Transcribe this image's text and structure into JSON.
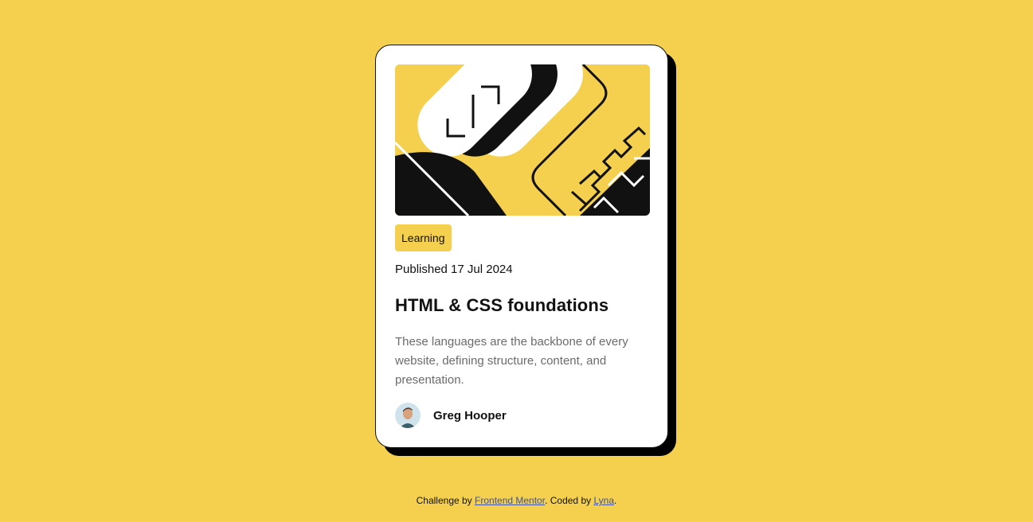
{
  "card": {
    "category": "Learning",
    "published": "Published 17 Jul 2024",
    "title": "HTML & CSS foundations",
    "description": "These languages are the backbone of every website, defining structure, content, and presentation.",
    "author": "Greg Hooper",
    "hero_image": "abstract-illustration"
  },
  "attribution": {
    "prefix": "Challenge by ",
    "link1": "Frontend Mentor",
    "middle": ". Coded by ",
    "link2": "Lyna",
    "suffix": "."
  },
  "colors": {
    "background": "#F4D04E",
    "card": "#FFFFFF",
    "text": "#111111",
    "muted": "#6B6B6B"
  }
}
